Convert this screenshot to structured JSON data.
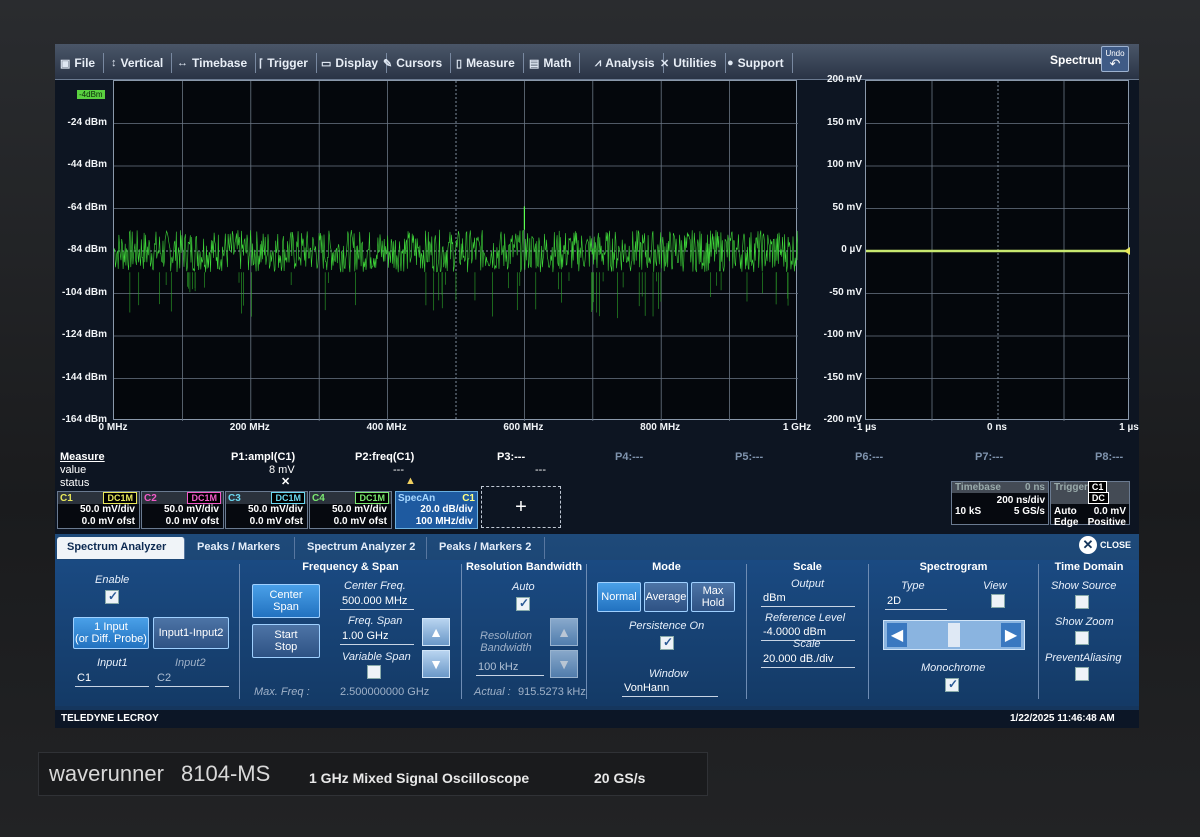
{
  "menu": [
    {
      "label": "File",
      "icon": "file-icon",
      "glyph": "▣"
    },
    {
      "label": "Vertical",
      "icon": "vertical-icon",
      "glyph": "↕"
    },
    {
      "label": "Timebase",
      "icon": "timebase-icon",
      "glyph": "↔"
    },
    {
      "label": "Trigger",
      "icon": "trigger-icon",
      "glyph": "⌈"
    },
    {
      "label": "Display",
      "icon": "display-icon",
      "glyph": "▭"
    },
    {
      "label": "Cursors",
      "icon": "cursors-icon",
      "glyph": "✎"
    },
    {
      "label": "Measure",
      "icon": "measure-icon",
      "glyph": "▯"
    },
    {
      "label": "Math",
      "icon": "math-icon",
      "glyph": "▤"
    },
    {
      "label": "Analysis",
      "icon": "analysis-icon",
      "glyph": "⩘"
    },
    {
      "label": "Utilities",
      "icon": "utilities-icon",
      "glyph": "✕"
    },
    {
      "label": "Support",
      "icon": "support-icon",
      "glyph": "●"
    }
  ],
  "spectrum_label": "Spectrum",
  "undo_label": "Undo",
  "spectrum_grid": {
    "ref_badge": "-4dBm",
    "y_labels": [
      "-24 dBm",
      "-44 dBm",
      "-64 dBm",
      "-84 dBm",
      "-104 dBm",
      "-124 dBm",
      "-144 dBm",
      "-164 dBm"
    ],
    "x_labels": [
      "0 MHz",
      "200 MHz",
      "400 MHz",
      "600 MHz",
      "800 MHz",
      "1 GHz"
    ]
  },
  "time_grid": {
    "y_labels": [
      "200 mV",
      "150 mV",
      "100 mV",
      "50 mV",
      "0 µV",
      "-50 mV",
      "-100 mV",
      "-150 mV",
      "-200 mV"
    ],
    "x_labels": [
      "-1 µs",
      "0 ns",
      "1 µs"
    ]
  },
  "chart_data": [
    {
      "type": "line",
      "title": "",
      "xlabel": "",
      "ylabel": "",
      "x_unit": "MHz",
      "y_unit": "dBm",
      "xlim": [
        0,
        1000
      ],
      "ylim": [
        -164,
        -4
      ],
      "series": [
        {
          "values_desc": "noise floor",
          "noise_center": -84,
          "noise_band": [
            -94,
            -74
          ],
          "spike": {
            "x": 600,
            "y": -63
          }
        }
      ],
      "grid": true
    },
    {
      "type": "line",
      "title": "",
      "xlim": [
        -1,
        1
      ],
      "x_unit": "µs",
      "ylim": [
        -200,
        200
      ],
      "y_unit": "mV",
      "series": [
        {
          "flat_level": 0
        }
      ],
      "grid": true
    }
  ],
  "measure": {
    "header": "Measure",
    "row_value": "value",
    "row_status": "status",
    "params": [
      {
        "name": "P1:ampl(C1)",
        "value": "8 mV",
        "status": "✕"
      },
      {
        "name": "P2:freq(C1)",
        "value": "---",
        "status": "▲"
      },
      {
        "name": "P3:---",
        "value": "---",
        "status": ""
      },
      {
        "name": "P4:---",
        "value": "",
        "status": ""
      },
      {
        "name": "P5:---",
        "value": "",
        "status": ""
      },
      {
        "name": "P6:---",
        "value": "",
        "status": ""
      },
      {
        "name": "P7:---",
        "value": "",
        "status": ""
      },
      {
        "name": "P8:---",
        "value": "",
        "status": ""
      }
    ]
  },
  "channels": [
    {
      "name": "C1",
      "coupling": "DC1M",
      "vdiv": "50.0 mV/div",
      "offset": "0.0 mV ofst",
      "color": "#e8e85a"
    },
    {
      "name": "C2",
      "coupling": "DC1M",
      "vdiv": "50.0 mV/div",
      "offset": "0.0 mV ofst",
      "color": "#f05ac8"
    },
    {
      "name": "C3",
      "coupling": "DC1M",
      "vdiv": "50.0 mV/div",
      "offset": "0.0 mV ofst",
      "color": "#6ad8f0"
    },
    {
      "name": "C4",
      "coupling": "DC1M",
      "vdiv": "50.0 mV/div",
      "offset": "0.0 mV ofst",
      "color": "#7ae870"
    }
  ],
  "specan": {
    "name": "SpecAn",
    "source": "C1",
    "line1": "20.0 dB/div",
    "line2": "100 MHz/div"
  },
  "add_label": "+",
  "timebase": {
    "title": "Timebase",
    "value": "0 ns",
    "rate": "200 ns/div",
    "samples": "10 kS",
    "srate": "5 GS/s"
  },
  "trigger": {
    "title": "Trigger",
    "src": "C1",
    "coupling": "DC",
    "mode": "Auto",
    "level": "0.0 mV",
    "type": "Edge",
    "slope": "Positive"
  },
  "tabs": [
    "Spectrum Analyzer",
    "Peaks / Markers",
    "Spectrum Analyzer 2",
    "Peaks / Markers 2"
  ],
  "close_label": "CLOSE",
  "panel": {
    "enable": "Enable",
    "btn_1input": "1 Input\n(or Diff. Probe)",
    "btn_diff": "Input1-Input2",
    "input1_label": "Input1",
    "input1_value": "C1",
    "input2_label": "Input2",
    "input2_value": "C2",
    "fs_title": "Frequency & Span",
    "btn_center": "Center\nSpan",
    "btn_start": "Start\nStop",
    "center_label": "Center Freq.",
    "center_value": "500.000 MHz",
    "span_label": "Freq. Span",
    "span_value": "1.00 GHz",
    "varspan_label": "Variable Span",
    "maxfreq_label": "Max. Freq :",
    "maxfreq_value": "2.500000000 GHz",
    "rb_title": "Resolution Bandwidth",
    "auto_label": "Auto",
    "rbw_label": "Resolution\nBandwidth",
    "rbw_value": "100 kHz",
    "actual_label": "Actual :",
    "actual_value": "915.5273 kHz",
    "mode_title": "Mode",
    "mode_normal": "Normal",
    "mode_average": "Average",
    "mode_maxhold": "Max\nHold",
    "persistence_label": "Persistence On",
    "window_label": "Window",
    "window_value": "VonHann",
    "scale_title": "Scale",
    "output_label": "Output",
    "output_value": "dBm",
    "ref_label": "Reference Level",
    "ref_value": "-4.0000 dBm",
    "scale_label": "Scale",
    "scale_value": "20.000 dB./div",
    "spg_title": "Spectrogram",
    "type_label": "Type",
    "type_value": "2D",
    "view_label": "View",
    "mono_label": "Monochrome",
    "td_title": "Time Domain",
    "show_source": "Show Source",
    "show_zoom": "Show Zoom",
    "prevent_alias": "PreventAliasing"
  },
  "status": {
    "brand": "TELEDYNE LECROY",
    "datetime": "1/22/2025 11:46:48 AM"
  },
  "bezel": {
    "model_name": "waverunner",
    "model_num": "8104-MS",
    "desc": "1 GHz Mixed Signal Oscilloscope",
    "rate": "20 GS/s"
  }
}
